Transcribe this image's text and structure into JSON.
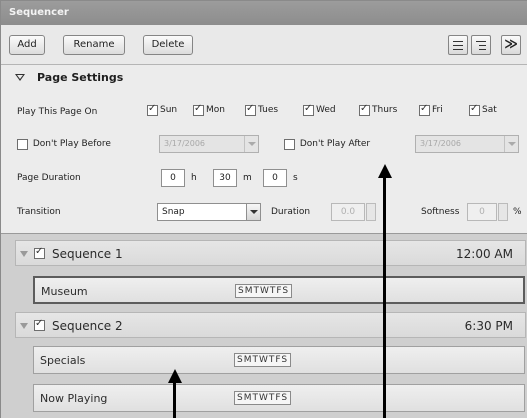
{
  "window": {
    "title": "Sequencer"
  },
  "toolbar": {
    "add_label": "Add",
    "rename_label": "Rename",
    "delete_label": "Delete",
    "icons": [
      "list-view-icon",
      "detail-view-icon",
      "expand-panel-icon"
    ],
    "expand_glyph": "≫"
  },
  "settings": {
    "header": "Page Settings",
    "play_on_label": "Play This Page On",
    "days": [
      {
        "label": "Sun",
        "checked": true
      },
      {
        "label": "Mon",
        "checked": true
      },
      {
        "label": "Tues",
        "checked": true
      },
      {
        "label": "Wed",
        "checked": true
      },
      {
        "label": "Thurs",
        "checked": true
      },
      {
        "label": "Fri",
        "checked": true
      },
      {
        "label": "Sat",
        "checked": true
      }
    ],
    "dont_play_before_label": "Don't Play Before",
    "dont_play_before_checked": false,
    "dont_play_before_value": "3/17/2006",
    "dont_play_after_label": "Don't Play After",
    "dont_play_after_checked": false,
    "dont_play_after_value": "3/17/2006",
    "duration_label": "Page Duration",
    "hours": "0",
    "hours_unit": "h",
    "minutes": "30",
    "minutes_unit": "m",
    "seconds": "0",
    "seconds_unit": "s",
    "transition_label": "Transition",
    "transition_value": "Snap",
    "trans_duration_label": "Duration",
    "trans_duration_value": "0.0",
    "softness_label": "Softness",
    "softness_value": "0",
    "softness_unit": "%"
  },
  "sequences": [
    {
      "name": "Sequence 1",
      "time": "12:00 AM",
      "checked": true,
      "pages": [
        {
          "name": "Museum",
          "days": "SMTWTFS",
          "selected": true
        }
      ]
    },
    {
      "name": "Sequence 2",
      "time": "6:30 PM",
      "checked": true,
      "pages": [
        {
          "name": "Specials",
          "days": "SMTWTFS",
          "selected": false
        },
        {
          "name": "Now Playing",
          "days": "SMTWTFS",
          "selected": false
        }
      ]
    }
  ],
  "colors": {
    "titlebar": "#8d8d8d",
    "panel": "#e6e6e6",
    "list_bg": "#cfcfcf",
    "callout_arrow": "#000000"
  }
}
